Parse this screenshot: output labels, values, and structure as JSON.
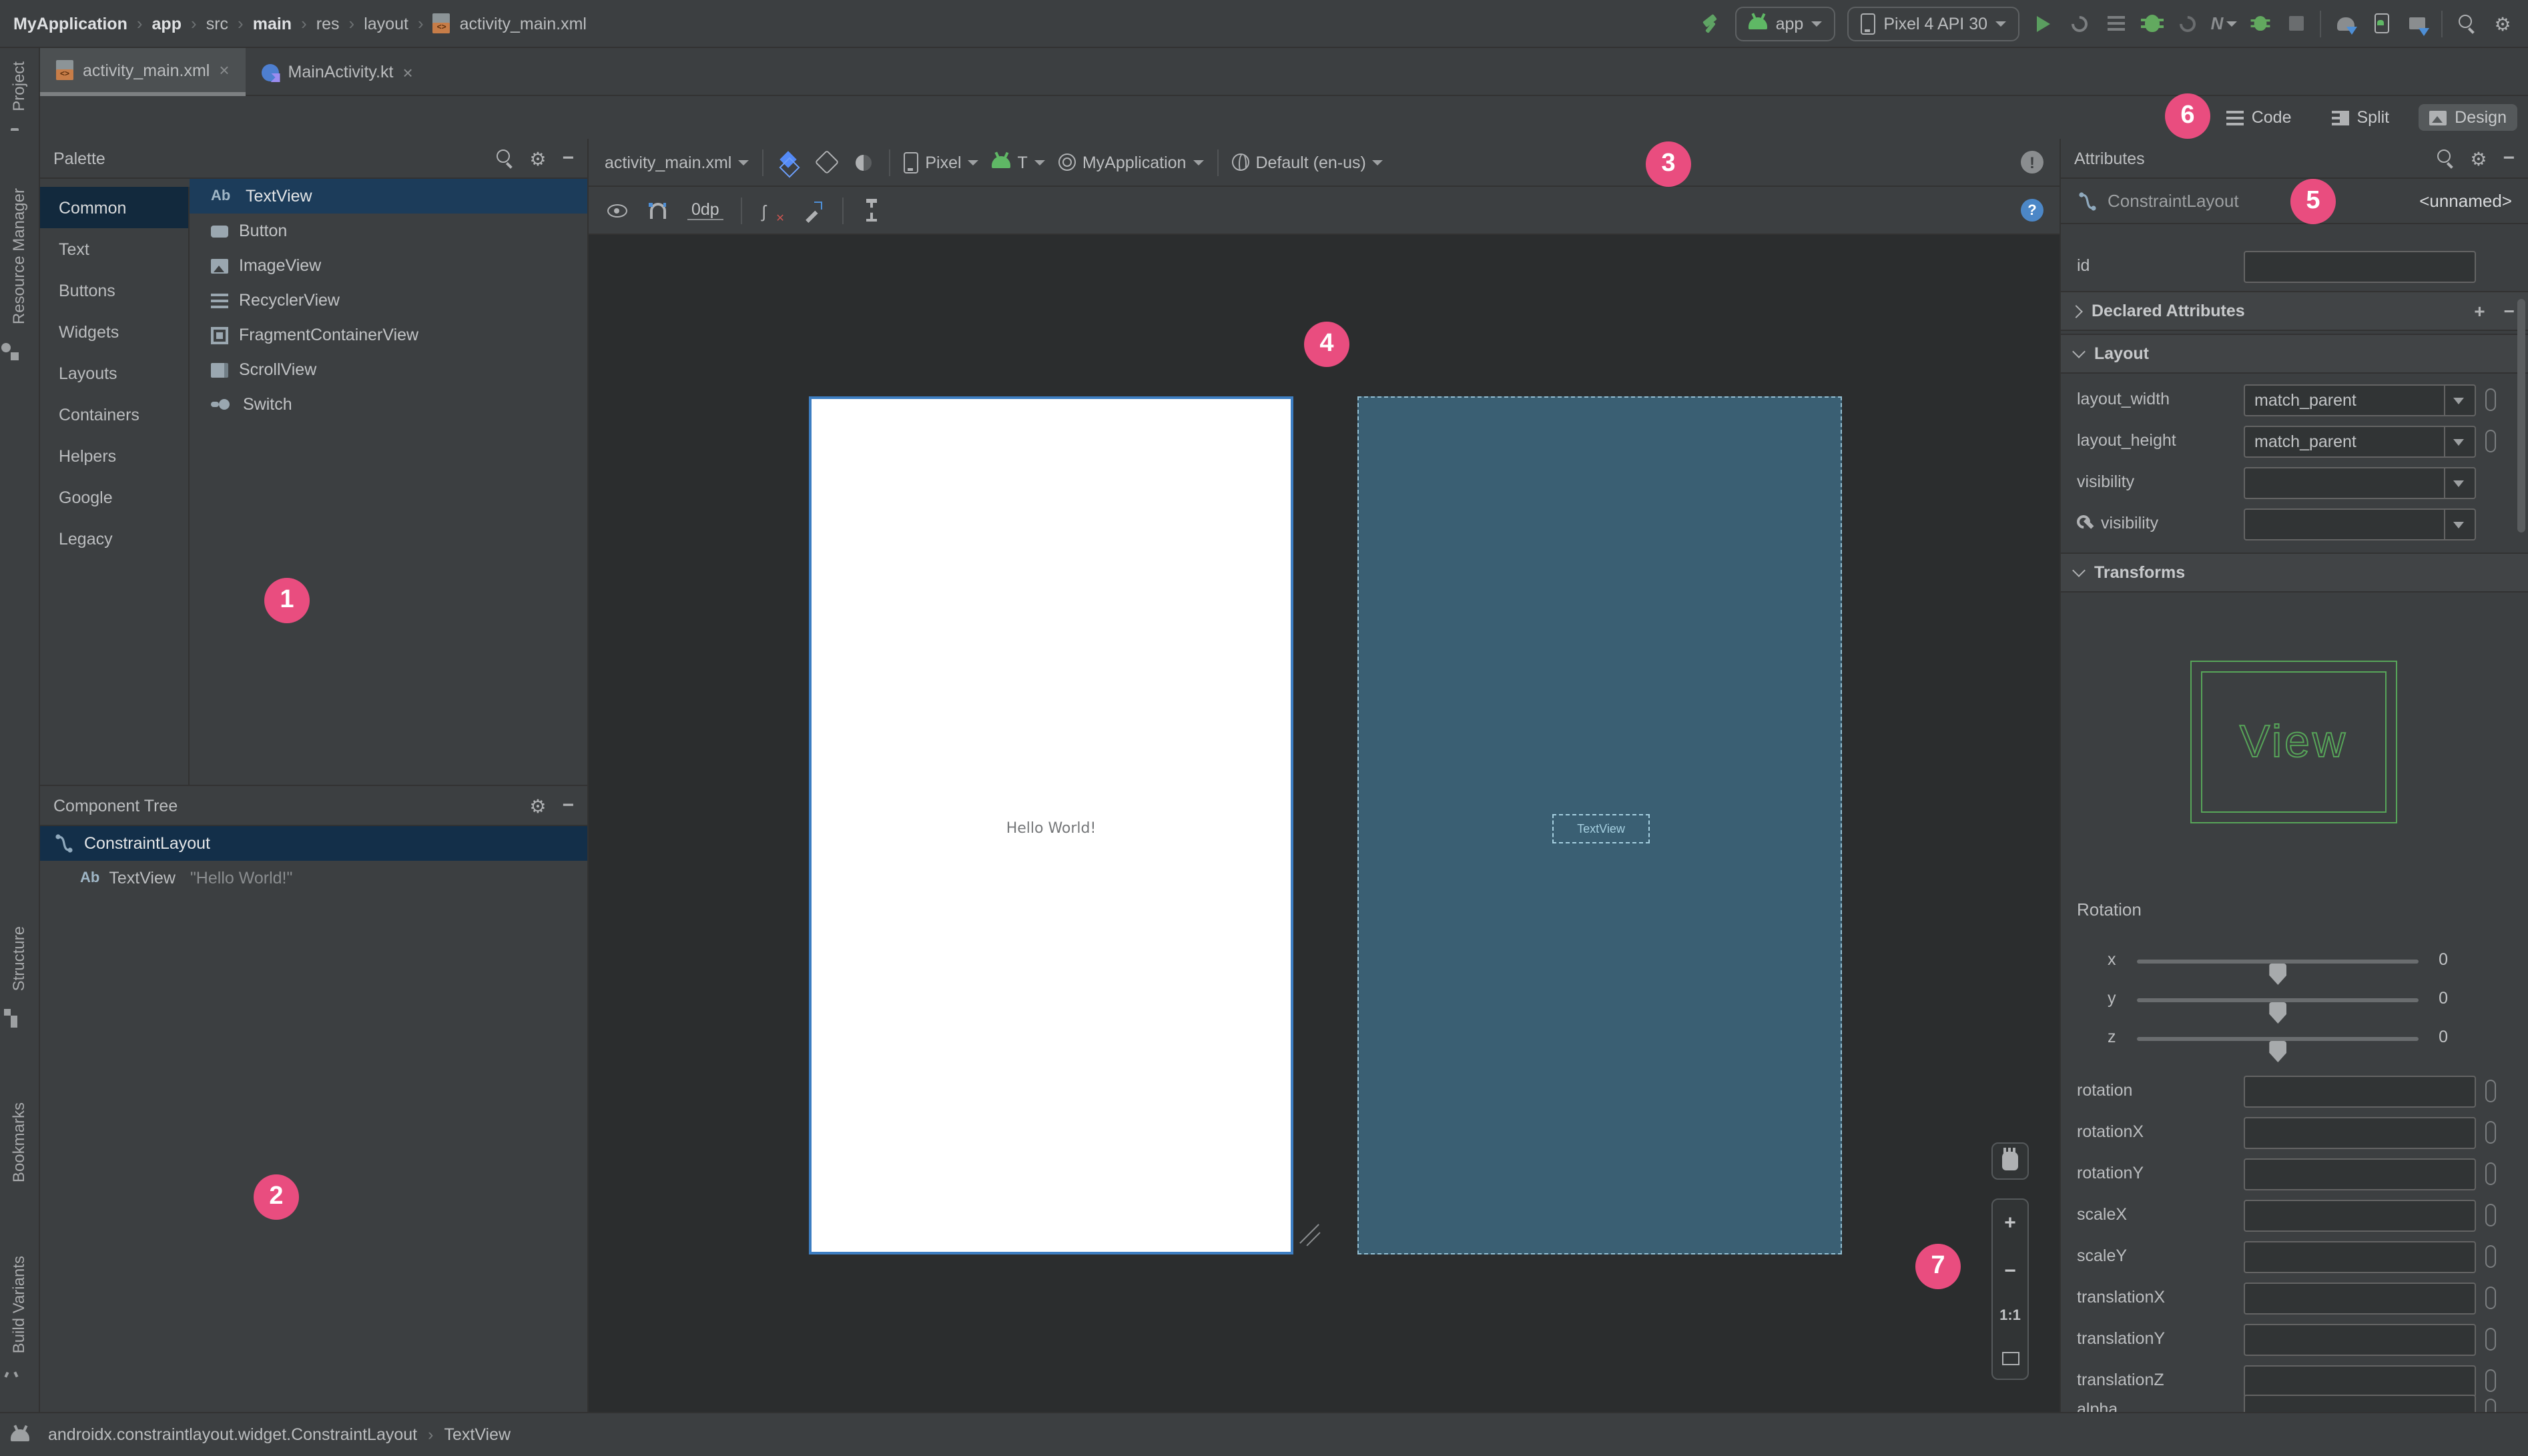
{
  "main_toolbar": {
    "breadcrumbs": [
      "MyApplication",
      "app",
      "src",
      "main",
      "res",
      "layout",
      "activity_main.xml"
    ],
    "run_config_label": "app",
    "device_label": "Pixel 4 API 30"
  },
  "editor_tabs": [
    {
      "label": "activity_main.xml",
      "close": "×"
    },
    {
      "label": "MainActivity.kt",
      "close": "×"
    }
  ],
  "view_modes": {
    "code": "Code",
    "split": "Split",
    "design": "Design",
    "selected": "Design"
  },
  "left_strip": {
    "project": "Project",
    "resource_manager": "Resource Manager",
    "structure": "Structure",
    "bookmarks": "Bookmarks",
    "build_variants": "Build Variants"
  },
  "palette": {
    "title": "Palette",
    "categories": [
      {
        "label": "Common",
        "selected": true
      },
      {
        "label": "Text"
      },
      {
        "label": "Buttons"
      },
      {
        "label": "Widgets"
      },
      {
        "label": "Layouts"
      },
      {
        "label": "Containers"
      },
      {
        "label": "Helpers"
      },
      {
        "label": "Google"
      },
      {
        "label": "Legacy"
      }
    ],
    "components": [
      {
        "icon": "Ab",
        "label": "TextView",
        "selected": true
      },
      {
        "icon": "button",
        "label": "Button"
      },
      {
        "icon": "image",
        "label": "ImageView"
      },
      {
        "icon": "list",
        "label": "RecyclerView"
      },
      {
        "icon": "fragment",
        "label": "FragmentContainerView"
      },
      {
        "icon": "scroll",
        "label": "ScrollView"
      },
      {
        "icon": "switch",
        "label": "Switch"
      }
    ]
  },
  "component_tree": {
    "title": "Component Tree",
    "items": [
      {
        "label": "ConstraintLayout",
        "selected": true
      },
      {
        "icon": "Ab",
        "label": "TextView",
        "value": "\"Hello World!\""
      }
    ]
  },
  "design_toolbar": {
    "file": "activity_main.xml",
    "device": "Pixel",
    "api": "T",
    "theme": "MyApplication",
    "locale": "Default (en-us)",
    "default_margin": "0dp",
    "error_badge": "!",
    "help_badge": "?"
  },
  "design_surface": {
    "device_text": "Hello World!",
    "blueprint_component_label": "TextView"
  },
  "zoom_controls": {
    "zoom_in": "+",
    "zoom_out": "−",
    "actual_size": "1:1"
  },
  "attributes_panel": {
    "title": "Attributes",
    "component_type": "ConstraintLayout",
    "component_id": "<unnamed>",
    "id_label": "id",
    "id_value": "",
    "declared_attributes_label": "Declared Attributes",
    "layout_section_label": "Layout",
    "rows": {
      "layout_width": {
        "label": "layout_width",
        "value": "match_parent"
      },
      "layout_height": {
        "label": "layout_height",
        "value": "match_parent"
      },
      "visibility": {
        "label": "visibility",
        "value": ""
      },
      "tools_visibility": {
        "label": "visibility",
        "value": ""
      }
    },
    "transforms_section_label": "Transforms",
    "view_preview_label": "View",
    "rotation_label": "Rotation",
    "sliders": [
      {
        "axis": "x",
        "value": "0"
      },
      {
        "axis": "y",
        "value": "0"
      },
      {
        "axis": "z",
        "value": "0"
      }
    ],
    "fields": [
      {
        "label": "rotation",
        "value": ""
      },
      {
        "label": "rotationX",
        "value": ""
      },
      {
        "label": "rotationY",
        "value": ""
      },
      {
        "label": "scaleX",
        "value": ""
      },
      {
        "label": "scaleY",
        "value": ""
      },
      {
        "label": "translationX",
        "value": ""
      },
      {
        "label": "translationY",
        "value": ""
      },
      {
        "label": "translationZ",
        "value": ""
      },
      {
        "label": "alpha",
        "value": ""
      }
    ]
  },
  "status_bar": {
    "class_path": "androidx.constraintlayout.widget.ConstraintLayout",
    "selected_component": "TextView"
  },
  "badges": [
    {
      "n": "1"
    },
    {
      "n": "2"
    },
    {
      "n": "3"
    },
    {
      "n": "4"
    },
    {
      "n": "5"
    },
    {
      "n": "6"
    },
    {
      "n": "7"
    }
  ],
  "colors": {
    "accent_pink": "#E94D7F",
    "selection_blue": "#1C3C5A",
    "blueprint_bg": "#3A5F73",
    "android_green": "#5FB865",
    "device_border_blue": "#3D7EC2",
    "panel_bg": "#3C3F41",
    "surface_bg": "#2B2D2E"
  }
}
